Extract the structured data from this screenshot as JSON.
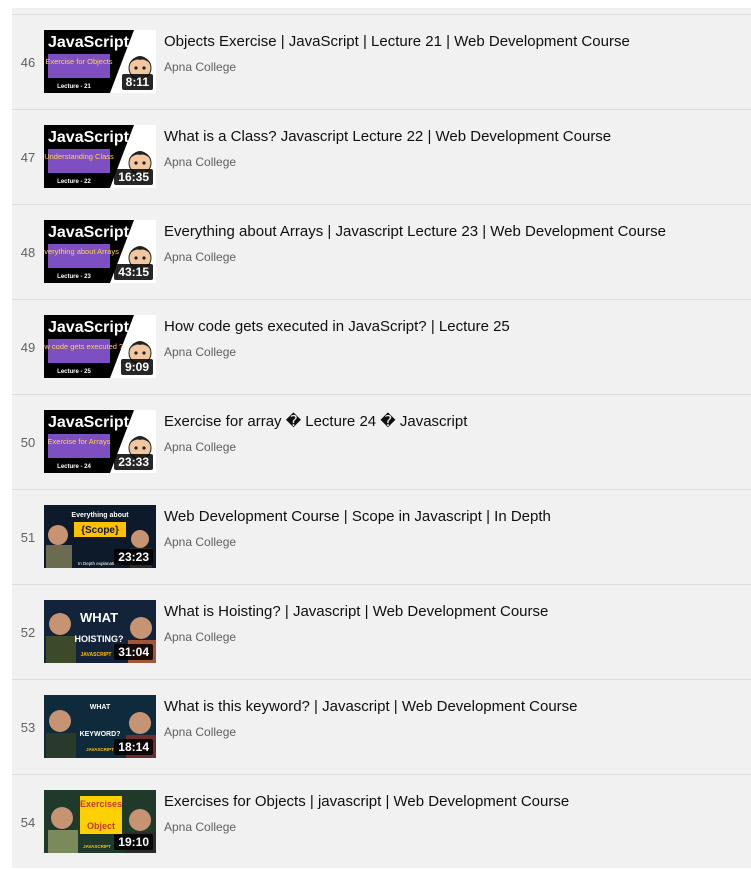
{
  "playlist": {
    "items": [
      {
        "index": "46",
        "title": "Objects Exercise | JavaScript | Lecture 21 | Web Development Course",
        "channel": "Apna College",
        "duration": "8:11",
        "thumb": {
          "style": "js",
          "heading": "JavaScript",
          "caption": "Exercise for Objects",
          "lecture": "Lecture - 21"
        }
      },
      {
        "index": "47",
        "title": "What is a Class? Javascript Lecture 22 | Web Development Course",
        "channel": "Apna College",
        "duration": "16:35",
        "thumb": {
          "style": "js",
          "heading": "JavaScript",
          "caption": "Understanding Class",
          "lecture": "Lecture - 22"
        }
      },
      {
        "index": "48",
        "title": "Everything about Arrays | Javascript Lecture 23 | Web Development Course",
        "channel": "Apna College",
        "duration": "43:15",
        "thumb": {
          "style": "js",
          "heading": "JavaScript",
          "caption": "Everything about Arrays",
          "lecture": "Lecture - 23"
        }
      },
      {
        "index": "49",
        "title": "How code gets executed in JavaScript? | Lecture 25",
        "channel": "Apna College",
        "duration": "9:09",
        "thumb": {
          "style": "js",
          "heading": "JavaScript",
          "caption": "How code gets executed ?",
          "lecture": "Lecture - 25"
        }
      },
      {
        "index": "50",
        "title": "Exercise for array � Lecture 24 � Javascript",
        "channel": "Apna College",
        "duration": "23:33",
        "thumb": {
          "style": "js",
          "heading": "JavaScript",
          "caption": "Exercise for Arrays",
          "lecture": "Lecture - 24"
        }
      },
      {
        "index": "51",
        "title": "Web Development Course | Scope in Javascript | In Depth",
        "channel": "Apna College",
        "duration": "23:23",
        "thumb": {
          "style": "scope",
          "heading": "Everything about",
          "caption": "{Scope}",
          "lecture": "In Depth explanation"
        }
      },
      {
        "index": "52",
        "title": "What is Hoisting? | Javascript | Web Development Course",
        "channel": "Apna College",
        "duration": "31:04",
        "thumb": {
          "style": "hoist",
          "heading": "WHAT",
          "caption": "HOISTING?",
          "lecture": "JAVASCRIPT"
        }
      },
      {
        "index": "53",
        "title": "What is this keyword? | Javascript | Web Development Course",
        "channel": "Apna College",
        "duration": "18:14",
        "thumb": {
          "style": "this",
          "heading": "WHAT",
          "caption": "KEYWORD?",
          "lecture": "JAVASCRIPT"
        }
      },
      {
        "index": "54",
        "title": "Exercises for Objects | javascript | Web Development Course",
        "channel": "Apna College",
        "duration": "19:10",
        "thumb": {
          "style": "objects",
          "heading": "Exercises",
          "caption": "Object",
          "lecture": "JAVASCRIPT"
        }
      }
    ]
  }
}
